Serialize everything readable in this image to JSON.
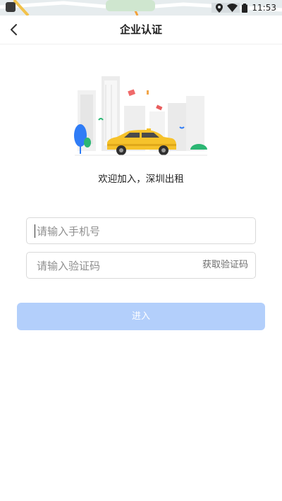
{
  "status_bar": {
    "time": "11:53"
  },
  "header": {
    "title": "企业认证"
  },
  "welcome_text": "欢迎加入，深圳出租",
  "form": {
    "phone_placeholder": "请输入手机号",
    "code_placeholder": "请输入验证码",
    "get_code_label": "获取验证码",
    "submit_label": "进入"
  },
  "colors": {
    "primary_disabled": "#b3cffb",
    "taxi_yellow": "#f6c22b",
    "accent_blue": "#2f7cf6",
    "accent_green": "#2bb673"
  },
  "icons": {
    "back": "chevron-left-icon",
    "location": "location-icon",
    "wifi": "wifi-icon",
    "battery": "battery-icon"
  }
}
